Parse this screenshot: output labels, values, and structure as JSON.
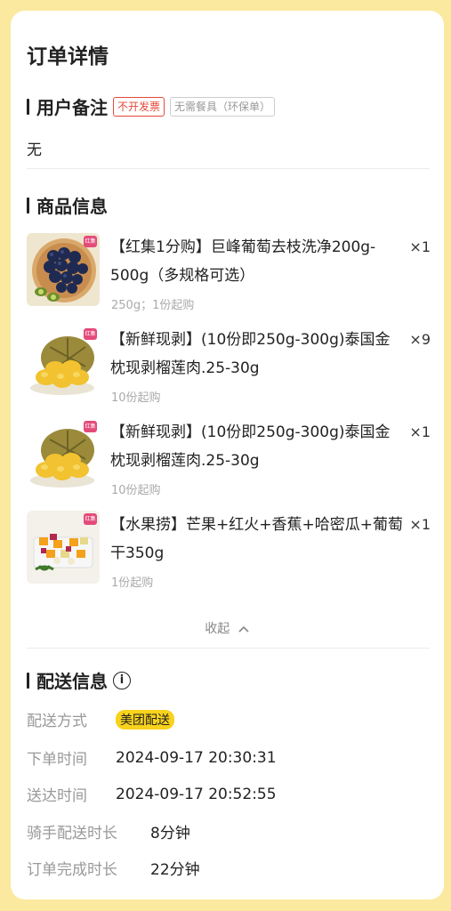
{
  "page_title": "订单详情",
  "remark": {
    "title": "用户备注",
    "tags": [
      "不开发票",
      "无需餐具（环保单）"
    ],
    "content": "无"
  },
  "goods": {
    "title": "商品信息",
    "items": [
      {
        "name": "【红集1分购】巨峰葡萄去枝洗净200g-500g（多规格可选）",
        "qty": "×1",
        "sub": "250g；1份起购",
        "badge": "红集"
      },
      {
        "name": "【新鲜现剥】(10份即250g-300g)泰国金枕现剥榴莲肉.25-30g",
        "qty": "×9",
        "sub": "10份起购",
        "badge": "红集"
      },
      {
        "name": "【新鲜现剥】(10份即250g-300g)泰国金枕现剥榴莲肉.25-30g",
        "qty": "×1",
        "sub": "10份起购",
        "badge": "红集"
      },
      {
        "name": "【水果捞】芒果+红火+香蕉+哈密瓜+葡萄干350g",
        "qty": "×1",
        "sub": "1份起购",
        "badge": "红集"
      }
    ],
    "collapse_label": "收起"
  },
  "delivery": {
    "title": "配送信息",
    "info_icon": "info-icon",
    "method_label": "配送方式",
    "method_value": "美团配送",
    "rows": [
      {
        "label": "下单时间",
        "value": "2024-09-17 20:30:31"
      },
      {
        "label": "送达时间",
        "value": "2024-09-17 20:52:55"
      },
      {
        "label": "骑手配送时长",
        "value": "8分钟"
      },
      {
        "label": "订单完成时长",
        "value": "22分钟"
      }
    ]
  },
  "colors": {
    "background": "#fbe9a0",
    "accent_red": "#e4493a",
    "meituan_yellow": "#f8d21b"
  }
}
